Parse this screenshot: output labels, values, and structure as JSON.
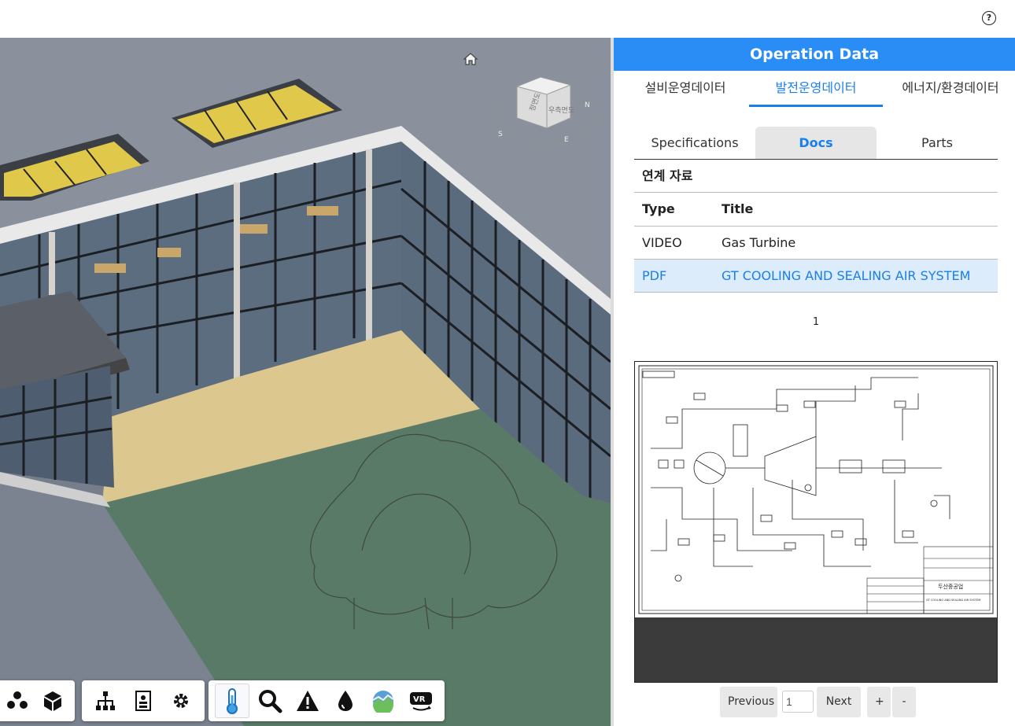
{
  "help_label": "?",
  "panel": {
    "title": "Operation Data",
    "main_tabs": [
      "설비운영데이터",
      "발전운영데이터",
      "에너지/환경데이터"
    ],
    "sub_tabs": [
      "Specifications",
      "Docs",
      "Parts"
    ],
    "section_title": "연계 자료",
    "table": {
      "headers": [
        "Type",
        "Title"
      ],
      "rows": [
        {
          "type": "VIDEO",
          "title": "Gas Turbine"
        },
        {
          "type": "PDF",
          "title": "GT COOLING AND SEALING AIR SYSTEM"
        }
      ]
    },
    "current_page": "1",
    "pager": {
      "previous": "Previous",
      "page_value": "1",
      "next": "Next",
      "zoom_in": "+",
      "zoom_out": "-"
    }
  },
  "viewcube": {
    "faces": [
      "정면도",
      "우측면도"
    ],
    "compass": [
      "S",
      "E",
      "N"
    ]
  },
  "pdf_titleblock": {
    "company": "두산중공업",
    "drawing_title": "GT COOLING AND SEALING AIR SYSTEM"
  },
  "toolbar": {
    "groups": [
      [
        "explode-icon",
        "model-cube-icon"
      ],
      [
        "model-tree-icon",
        "properties-icon",
        "settings-icon"
      ],
      [
        "temperature-icon",
        "search-icon",
        "warning-icon",
        "water-drop-icon",
        "environment-icon",
        "vr-icon"
      ]
    ],
    "active": "temperature-icon"
  },
  "colors": {
    "accent": "#2a8cf5",
    "selected_row": "#dcecfb",
    "active_text": "#1a7fea"
  }
}
